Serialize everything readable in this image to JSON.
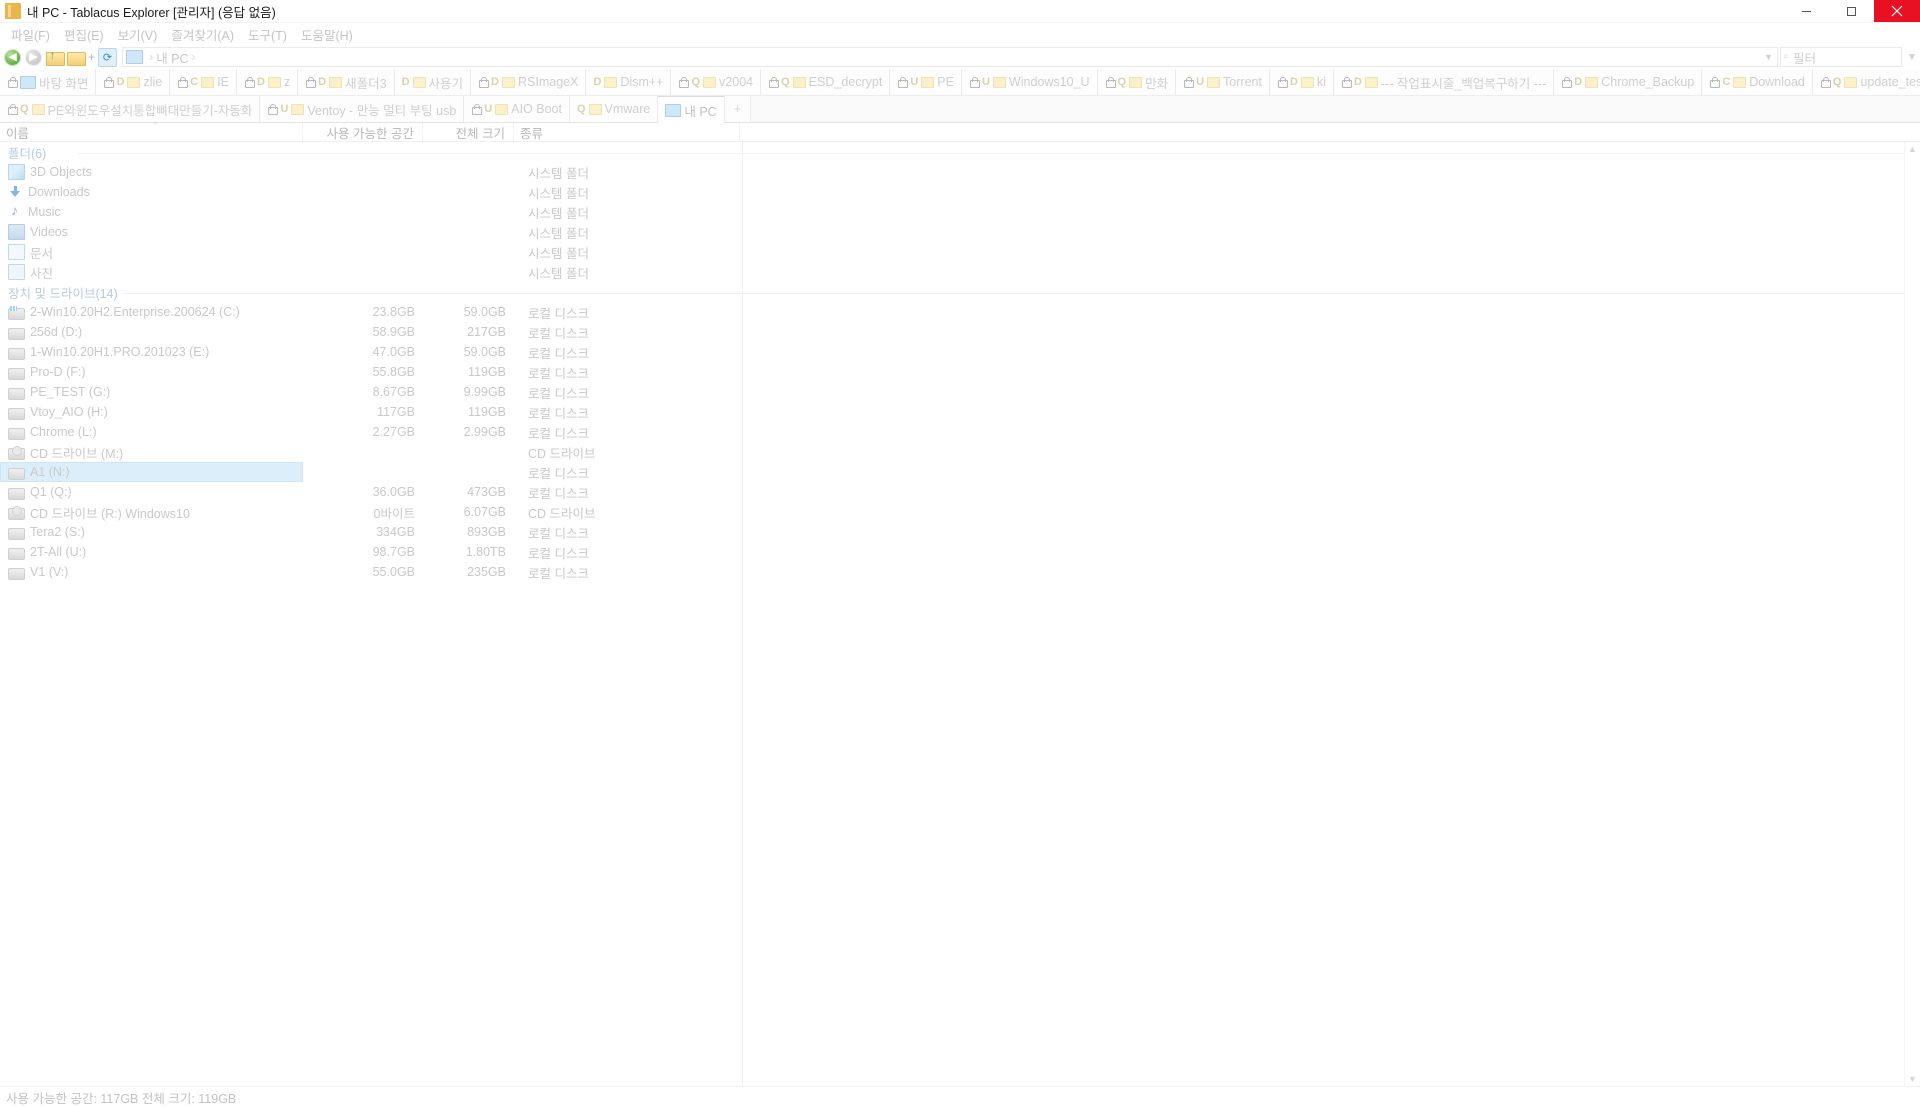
{
  "window": {
    "title": "내 PC - Tablacus Explorer [관리자] (응답 없음)",
    "minimize": "—",
    "maximize": "▢",
    "close": "✕"
  },
  "menu": [
    {
      "label": "파일(F)"
    },
    {
      "label": "편집(E)"
    },
    {
      "label": "보기(V)"
    },
    {
      "label": "즐겨찾기(A)"
    },
    {
      "label": "도구(T)"
    },
    {
      "label": "도움말(H)"
    }
  ],
  "toolbar": {
    "back": "◀",
    "forward": "▶",
    "up": "up-folder",
    "folder": "folder",
    "plus": "+",
    "refresh": "⟳",
    "address": {
      "root": "",
      "crumb1": "내 PC",
      "sep": "›"
    },
    "filter": {
      "placeholder": "필터",
      "icon": "⌕"
    },
    "funnel": "▼"
  },
  "tabs_row1": [
    {
      "icon": "pc",
      "label": "바탕 화면",
      "lock": true
    },
    {
      "icon": "drive",
      "drive": "D",
      "label": "zlie",
      "lock": true
    },
    {
      "icon": "drive",
      "drive": "C",
      "label": "IE",
      "lock": true
    },
    {
      "icon": "drive",
      "drive": "D",
      "label": "z",
      "lock": true
    },
    {
      "icon": "drive",
      "drive": "D",
      "label": "새폴더3",
      "lock": true
    },
    {
      "icon": "drive",
      "drive": "D",
      "label": "사용기",
      "lock": false
    },
    {
      "icon": "drive",
      "drive": "D",
      "label": "RSImageX",
      "lock": true
    },
    {
      "icon": "drive",
      "drive": "D",
      "label": "Dism++",
      "lock": false
    },
    {
      "icon": "drive",
      "drive": "Q",
      "label": "v2004",
      "lock": true
    },
    {
      "icon": "drive",
      "drive": "Q",
      "label": "ESD_decrypt",
      "lock": true
    },
    {
      "icon": "drive",
      "drive": "U",
      "label": "PE",
      "lock": true
    },
    {
      "icon": "drive",
      "drive": "U",
      "label": "Windows10_U",
      "lock": true
    },
    {
      "icon": "drive",
      "drive": "Q",
      "label": "만화",
      "lock": true
    },
    {
      "icon": "drive",
      "drive": "U",
      "label": "Torrent",
      "lock": true
    },
    {
      "icon": "drive",
      "drive": "D",
      "label": "ki",
      "lock": true
    },
    {
      "icon": "drive",
      "drive": "D",
      "label": "--- 작업표시줄_백업복구하기 ---",
      "lock": true
    },
    {
      "icon": "drive",
      "drive": "D",
      "label": "Chrome_Backup",
      "lock": true
    },
    {
      "icon": "drive",
      "drive": "C",
      "label": "Download",
      "lock": true
    },
    {
      "icon": "drive",
      "drive": "Q",
      "label": "update_test",
      "lock": true
    }
  ],
  "tabs_row2": [
    {
      "icon": "drive",
      "drive": "Q",
      "label": "PE와윈도우설치통합뼈대만들기-자동화",
      "lock": true,
      "active": false
    },
    {
      "icon": "drive",
      "drive": "U",
      "label": "Ventoy - 만능 멀티 부팅 usb",
      "lock": true,
      "active": false
    },
    {
      "icon": "drive",
      "drive": "U",
      "label": "AIO Boot",
      "lock": true,
      "active": false
    },
    {
      "icon": "drive",
      "drive": "Q",
      "label": "Vmware",
      "lock": false,
      "active": false
    },
    {
      "icon": "pc",
      "label": "내 PC",
      "lock": false,
      "active": true
    },
    {
      "icon": "none",
      "label": "+",
      "newtab": true
    }
  ],
  "columns": [
    {
      "key": "name",
      "label": "이름",
      "sorted": true
    },
    {
      "key": "free",
      "label": "사용 가능한 공간"
    },
    {
      "key": "total",
      "label": "전체 크기"
    },
    {
      "key": "type",
      "label": "종류"
    }
  ],
  "groups": [
    {
      "label": "폴더(6)",
      "rows": [
        {
          "icon": "3d",
          "name": "3D Objects",
          "free": "",
          "total": "",
          "type": "시스템 폴더"
        },
        {
          "icon": "dl",
          "name": "Downloads",
          "free": "",
          "total": "",
          "type": "시스템 폴더"
        },
        {
          "icon": "mu",
          "name": "Music",
          "free": "",
          "total": "",
          "type": "시스템 폴더"
        },
        {
          "icon": "vid",
          "name": "Videos",
          "free": "",
          "total": "",
          "type": "시스템 폴더"
        },
        {
          "icon": "doc",
          "name": "문서",
          "free": "",
          "total": "",
          "type": "시스템 폴더"
        },
        {
          "icon": "pic",
          "name": "사진",
          "free": "",
          "total": "",
          "type": "시스템 폴더"
        }
      ]
    },
    {
      "label": "장치 및 드라이브(14)",
      "rows": [
        {
          "icon": "drvwin",
          "name": "2-Win10.20H2.Enterprise.200624 (C:)",
          "free": "23.8GB",
          "total": "59.0GB",
          "type": "로컬 디스크"
        },
        {
          "icon": "drv",
          "name": "256d (D:)",
          "free": "58.9GB",
          "total": "217GB",
          "type": "로컬 디스크"
        },
        {
          "icon": "drv",
          "name": "1-Win10.20H1.PRO.201023 (E:)",
          "free": "47.0GB",
          "total": "59.0GB",
          "type": "로컬 디스크"
        },
        {
          "icon": "drv",
          "name": "Pro-D (F:)",
          "free": "55.8GB",
          "total": "119GB",
          "type": "로컬 디스크"
        },
        {
          "icon": "drv",
          "name": "PE_TEST (G:)",
          "free": "8.67GB",
          "total": "9.99GB",
          "type": "로컬 디스크"
        },
        {
          "icon": "drv",
          "name": "Vtoy_AIO (H:)",
          "free": "117GB",
          "total": "119GB",
          "type": "로컬 디스크"
        },
        {
          "icon": "drv",
          "name": "Chrome (L:)",
          "free": "2.27GB",
          "total": "2.99GB",
          "type": "로컬 디스크"
        },
        {
          "icon": "cd",
          "name": "CD 드라이브 (M:)",
          "free": "",
          "total": "",
          "type": "CD 드라이브"
        },
        {
          "icon": "drv",
          "name": "A1 (N:)",
          "free": "",
          "total": "",
          "type": "로컬 디스크",
          "selected": true
        },
        {
          "icon": "drv",
          "name": "Q1 (Q:)",
          "free": "36.0GB",
          "total": "473GB",
          "type": "로컬 디스크"
        },
        {
          "icon": "cd",
          "name": "CD 드라이브 (R:) Windows10",
          "free": "0바이트",
          "total": "6.07GB",
          "type": "CD 드라이브"
        },
        {
          "icon": "drv",
          "name": "Tera2 (S:)",
          "free": "334GB",
          "total": "893GB",
          "type": "로컬 디스크"
        },
        {
          "icon": "drv",
          "name": "2T-All (U:)",
          "free": "98.7GB",
          "total": "1.80TB",
          "type": "로컬 디스크"
        },
        {
          "icon": "drv",
          "name": "V1 (V:)",
          "free": "55.0GB",
          "total": "235GB",
          "type": "로컬 디스크"
        }
      ]
    }
  ],
  "scroll": {
    "up": "▲",
    "down": "▼"
  },
  "statusbar": {
    "text": "사용 가능한 공간: 117GB 전체 크기: 119GB"
  }
}
